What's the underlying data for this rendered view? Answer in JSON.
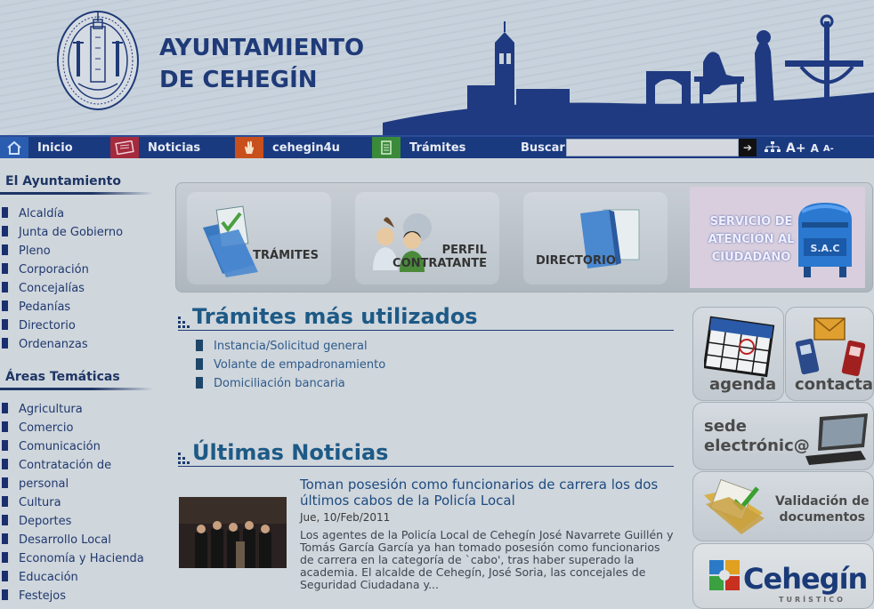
{
  "header": {
    "title_line1": "AYUNTAMIENTO",
    "title_line2": "DE CEHEGÍN"
  },
  "nav": {
    "items": [
      {
        "label": "Inicio",
        "icon": "home-icon"
      },
      {
        "label": "Noticias",
        "icon": "newspaper-icon"
      },
      {
        "label": "cehegin4u",
        "icon": "hand-icon"
      },
      {
        "label": "Trámites",
        "icon": "document-icon"
      }
    ],
    "search_label": "Buscar:",
    "search_value": "",
    "search_button": "➔",
    "tools": {
      "sitemap": "sitemap-icon",
      "font_increase": "A+",
      "font_normal": "A",
      "font_decrease": "A-"
    }
  },
  "sidebar": {
    "section1": {
      "heading": "El Ayuntamiento",
      "items": [
        "Alcaldía",
        "Junta de Gobierno",
        "Pleno",
        "Corporación",
        "Concejalías",
        "Pedanías",
        "Directorio",
        "Ordenanzas"
      ]
    },
    "section2": {
      "heading": "Áreas Temáticas",
      "items": [
        "Agricultura",
        "Comercio",
        "Comunicación",
        "Contratación de",
        "personal",
        "Cultura",
        "Deportes",
        "Desarrollo Local",
        "Economía y Hacienda",
        "Educación",
        "Festejos"
      ]
    }
  },
  "banner": {
    "tramites": "TRÁMITES",
    "perfil_line1": "PERFIL",
    "perfil_line2": "CONTRATANTE",
    "directorio": "DIRECTORIO",
    "sac_line1": "SERVICIO DE",
    "sac_line2": "ATENCIÓN AL",
    "sac_line3": "CIUDADANO",
    "sac_box": "S.A.C"
  },
  "tramites": {
    "heading": "Trámites más utilizados",
    "items": [
      "Instancia/Solicitud general",
      "Volante de empadronamiento",
      "Domiciliación bancaria"
    ]
  },
  "noticias": {
    "heading": "Últimas Noticias",
    "title": "Toman posesión como funcionarios de carrera los dos últimos cabos de la Policía Local",
    "date": "Jue, 10/Feb/2011",
    "body": "Los agentes de la Policía Local de Cehegín José Navarrete Guillén y Tomás García García ya han tomado posesión como funcionarios de carrera en la categoría de `cabo', tras haber superado la academia.   El alcalde de Cehegín, José Soria, las concejales de Seguridad Ciudadana y..."
  },
  "right_boxes": {
    "agenda": "agenda",
    "contactar": "contactar",
    "sede_line1": "sede",
    "sede_line2": "electrónic@",
    "validacion_line1": "Validación de",
    "validacion_line2": "documentos",
    "cehegin_logo": "Cehegín",
    "cehegin_sub": "TURÍSTICO"
  },
  "colors": {
    "nav_bg": "#1a3a80",
    "title": "#1f3a78",
    "heading": "#1d5a86"
  }
}
